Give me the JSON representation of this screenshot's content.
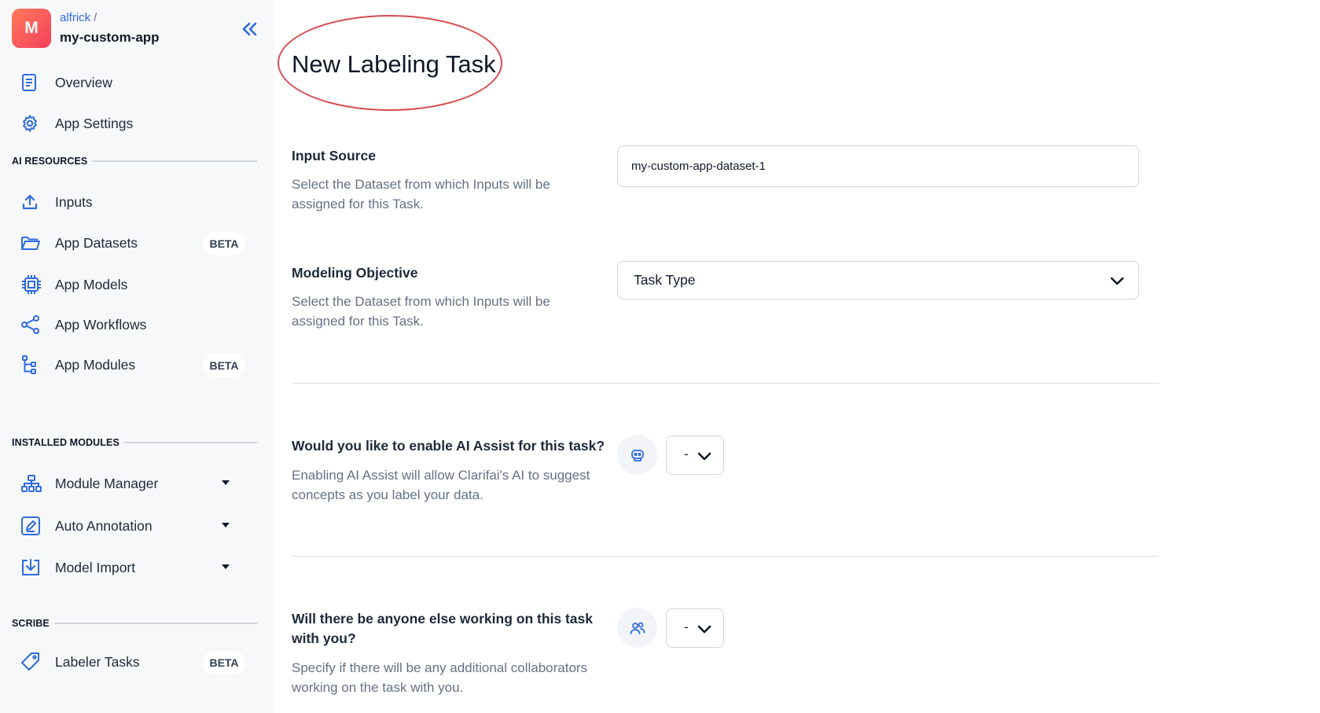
{
  "header": {
    "avatar_letter": "M",
    "org": "alfrick",
    "separator": "/",
    "app_name": "my-custom-app"
  },
  "sidebar": {
    "top_items": [
      {
        "label": "Overview",
        "icon": "document-icon"
      },
      {
        "label": "App Settings",
        "icon": "gear-icon"
      }
    ],
    "sections": {
      "ai_resources": "AI RESOURCES",
      "installed_modules": "INSTALLED MODULES",
      "scribe": "SCRIBE"
    },
    "ai_resources_items": [
      {
        "label": "Inputs",
        "icon": "upload-icon"
      },
      {
        "label": "App Datasets",
        "icon": "folder-icon",
        "badge": "BETA"
      },
      {
        "label": "App Models",
        "icon": "chip-icon"
      },
      {
        "label": "App Workflows",
        "icon": "share-nodes-icon"
      },
      {
        "label": "App Modules",
        "icon": "tree-icon",
        "badge": "BETA"
      }
    ],
    "installed_modules_items": [
      {
        "label": "Module Manager",
        "icon": "hierarchy-icon"
      },
      {
        "label": "Auto Annotation",
        "icon": "edit-box-icon"
      },
      {
        "label": "Model Import",
        "icon": "import-icon"
      }
    ],
    "scribe_items": [
      {
        "label": "Labeler Tasks",
        "icon": "tag-icon",
        "badge": "BETA"
      }
    ]
  },
  "main": {
    "title": "New Labeling Task",
    "input_source": {
      "label": "Input Source",
      "desc_line1": "Select the Dataset from which Inputs will be",
      "desc_line2": "assigned for this Task.",
      "value": "my-custom-app-dataset-1"
    },
    "modeling_objective": {
      "label": "Modeling Objective",
      "desc_line1": "Select the Dataset from which Inputs will be",
      "desc_line2": "assigned for this Task.",
      "select_value": "Task Type"
    },
    "ai_assist": {
      "label": "Would you like to enable AI Assist for this task?",
      "desc_line1": "Enabling AI Assist will allow Clarifai's AI to suggest",
      "desc_line2": "concepts as you label your data.",
      "select_value": "-"
    },
    "collaborators": {
      "label_line1": "Will there be anyone else working on this task",
      "label_line2": "with you?",
      "desc_line1": "Specify if there will be any additional collaborators",
      "desc_line2": "working on the task with you.",
      "select_value": "-"
    }
  },
  "colors": {
    "accent": "#2f6be0",
    "highlight_oval": "#d94a4f",
    "sidebar_bg": "#f7f8fa",
    "avatar_gradient_start": "#ff7a59",
    "avatar_gradient_end": "#f43f5e"
  }
}
